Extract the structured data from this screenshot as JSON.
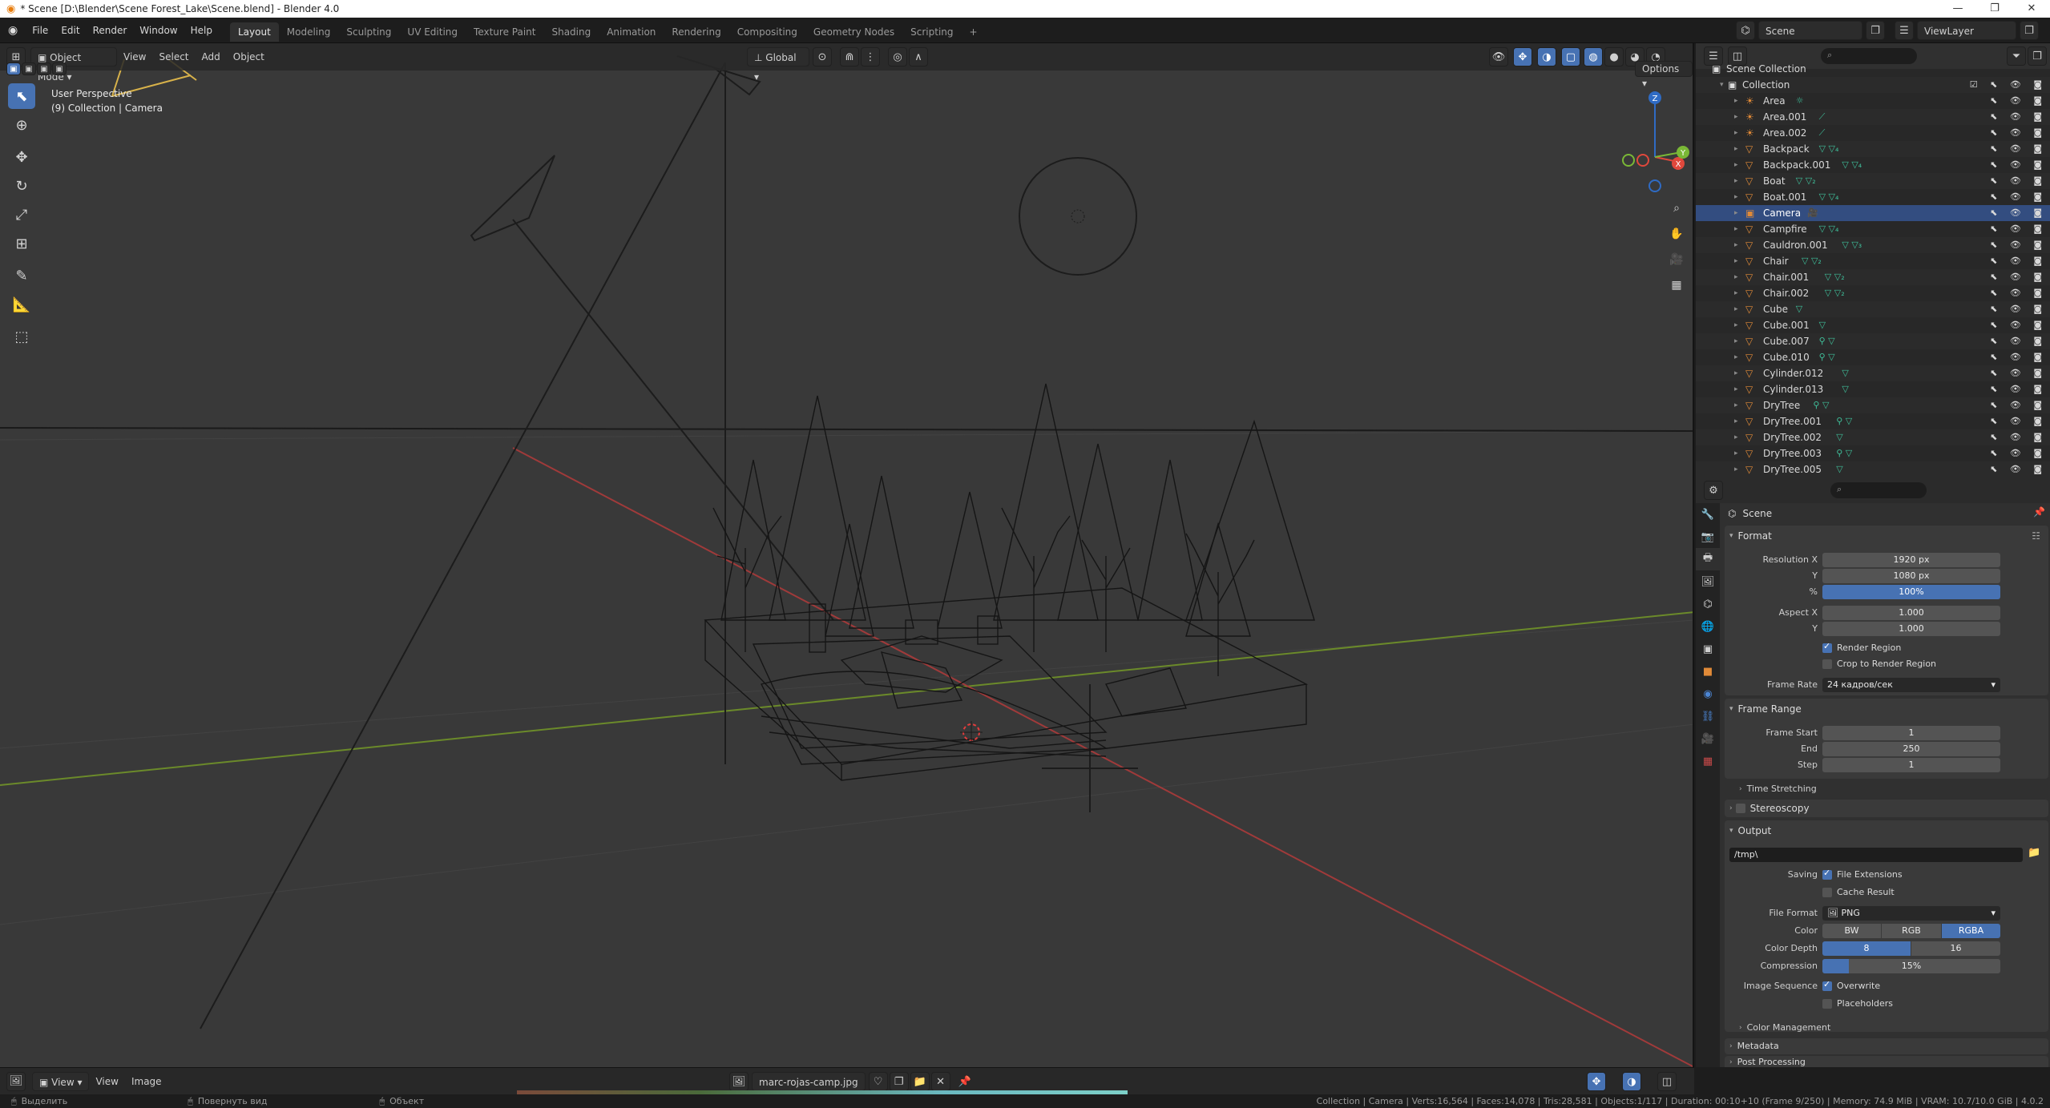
{
  "window": {
    "title": "* Scene [D:\\Blender\\Scene Forest_Lake\\Scene.blend] - Blender 4.0",
    "controls": [
      "—",
      "❐",
      "✕"
    ]
  },
  "menu": [
    "File",
    "Edit",
    "Render",
    "Window",
    "Help"
  ],
  "workspaces": [
    "Layout",
    "Modeling",
    "Sculpting",
    "UV Editing",
    "Texture Paint",
    "Shading",
    "Animation",
    "Rendering",
    "Compositing",
    "Geometry Nodes",
    "Scripting"
  ],
  "active_workspace": "Layout",
  "add_workspace": "+",
  "scene_selector": {
    "label": "Scene",
    "view_layer": "ViewLayer"
  },
  "viewport": {
    "mode": "Object Mode",
    "menus": [
      "View",
      "Select",
      "Add",
      "Object"
    ],
    "transform_orientation": "Global",
    "options_label": "Options",
    "info_line1": "User Perspective",
    "info_line2": "(9) Collection | Camera",
    "gizmo": {
      "z": "Z",
      "y": "Y",
      "x": "X"
    }
  },
  "outliner": {
    "root": "Scene Collection",
    "collection": "Collection",
    "selected": "Camera",
    "items": [
      "Area",
      "Area.001",
      "Area.002",
      "Backpack",
      "Backpack.001",
      "Boat",
      "Boat.001",
      "Camera",
      "Campfire",
      "Cauldron.001",
      "Chair",
      "Chair.001",
      "Chair.002",
      "Cube",
      "Cube.001",
      "Cube.007",
      "Cube.010",
      "Cylinder.012",
      "Cylinder.013",
      "DryTree",
      "DryTree.001",
      "DryTree.002",
      "DryTree.003",
      "DryTree.005"
    ]
  },
  "properties": {
    "context": "Scene",
    "format": {
      "title": "Format",
      "resolution_x_label": "Resolution X",
      "resolution_x": "1920 px",
      "resolution_y_label": "Y",
      "resolution_y": "1080 px",
      "percent_label": "%",
      "percent": "100%",
      "aspect_x_label": "Aspect X",
      "aspect_x": "1.000",
      "aspect_y_label": "Y",
      "aspect_y": "1.000",
      "render_region": "Render Region",
      "crop_region": "Crop to Render Region",
      "frame_rate_label": "Frame Rate",
      "frame_rate": "24 кадров/сек"
    },
    "frame_range": {
      "title": "Frame Range",
      "start_label": "Frame Start",
      "start": "1",
      "end_label": "End",
      "end": "250",
      "step_label": "Step",
      "step": "1",
      "time_stretching": "Time Stretching"
    },
    "stereoscopy": "Stereoscopy",
    "output": {
      "title": "Output",
      "path": "/tmp\\",
      "saving_label": "Saving",
      "file_extensions": "File Extensions",
      "cache_result": "Cache Result",
      "file_format_label": "File Format",
      "file_format": "PNG",
      "color_label": "Color",
      "color_options": [
        "BW",
        "RGB",
        "RGBA"
      ],
      "color_selected": "RGBA",
      "depth_label": "Color Depth",
      "depth_options": [
        "8",
        "16"
      ],
      "compression_label": "Compression",
      "compression": "15%",
      "compression_fraction": 0.15,
      "image_sequence_label": "Image Sequence",
      "overwrite": "Overwrite",
      "placeholders": "Placeholders",
      "color_management": "Color Management"
    },
    "metadata": "Metadata",
    "post_processing": "Post Processing"
  },
  "bottom_editor": {
    "menus": [
      "View",
      "Image"
    ],
    "view_label": "View",
    "image_name": "marc-rojas-camp.jpg"
  },
  "status": {
    "left1": "Выделить",
    "left2": "Повернуть вид",
    "left3": "Объект",
    "right": "Collection | Camera | Verts:16,564 | Faces:14,078 | Tris:28,581 | Objects:1/117 | Duration: 00:10+10 (Frame 9/250) | Memory: 74.9 MiB | VRAM: 10.7/10.0 GiB | 4.0.2"
  },
  "colors": {
    "accent": "#4772b3",
    "selection_row": "#334d80",
    "mesh_icon": "#e08a38",
    "modifier_icon": "#3fbf9a"
  }
}
